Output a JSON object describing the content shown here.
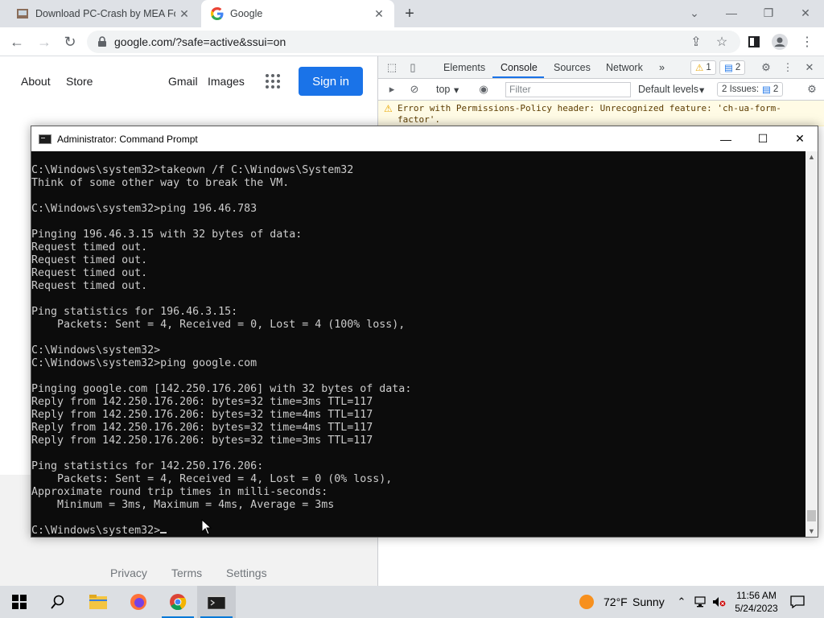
{
  "browser": {
    "tabs": [
      {
        "title": "Download PC-Crash by MEA Fore",
        "close": "✕"
      },
      {
        "title": "Google",
        "close": "✕"
      }
    ],
    "new_tab": "+",
    "url": "google.com/?safe=active&ssui=on"
  },
  "google": {
    "links": {
      "about": "About",
      "store": "Store",
      "gmail": "Gmail",
      "images": "Images"
    },
    "sign_in": "Sign in",
    "footer": {
      "privacy": "Privacy",
      "terms": "Terms",
      "settings": "Settings"
    }
  },
  "devtools": {
    "tabs": [
      "Elements",
      "Console",
      "Sources",
      "Network"
    ],
    "more": "»",
    "warnings": "1",
    "messages": "2",
    "context": "top",
    "filter_placeholder": "Filter",
    "levels": "Default levels",
    "issues_label": "2 Issues:",
    "issues_count": "2",
    "error_message": "Error with Permissions-Policy header: Unrecognized feature: 'ch-ua-form-factor'."
  },
  "cmd": {
    "title": "Administrator: Command Prompt",
    "lines": [
      "C:\\Windows\\system32>takeown /f C:\\Windows\\System32",
      "Think of some other way to break the VM.",
      "",
      "C:\\Windows\\system32>ping 196.46.783",
      "",
      "Pinging 196.46.3.15 with 32 bytes of data:",
      "Request timed out.",
      "Request timed out.",
      "Request timed out.",
      "Request timed out.",
      "",
      "Ping statistics for 196.46.3.15:",
      "    Packets: Sent = 4, Received = 0, Lost = 4 (100% loss),",
      "",
      "C:\\Windows\\system32>",
      "C:\\Windows\\system32>ping google.com",
      "",
      "Pinging google.com [142.250.176.206] with 32 bytes of data:",
      "Reply from 142.250.176.206: bytes=32 time=3ms TTL=117",
      "Reply from 142.250.176.206: bytes=32 time=4ms TTL=117",
      "Reply from 142.250.176.206: bytes=32 time=4ms TTL=117",
      "Reply from 142.250.176.206: bytes=32 time=3ms TTL=117",
      "",
      "Ping statistics for 142.250.176.206:",
      "    Packets: Sent = 4, Received = 4, Lost = 0 (0% loss),",
      "Approximate round trip times in milli-seconds:",
      "    Minimum = 3ms, Maximum = 4ms, Average = 3ms",
      "",
      "C:\\Windows\\system32>"
    ]
  },
  "taskbar": {
    "weather_temp": "72°F",
    "weather_desc": "Sunny",
    "time": "11:56 AM",
    "date": "5/24/2023"
  },
  "colors": {
    "accent": "#1a73e8",
    "console_bg": "#0c0c0c",
    "console_text": "#cccccc",
    "taskbar": "#dcdfe3"
  }
}
